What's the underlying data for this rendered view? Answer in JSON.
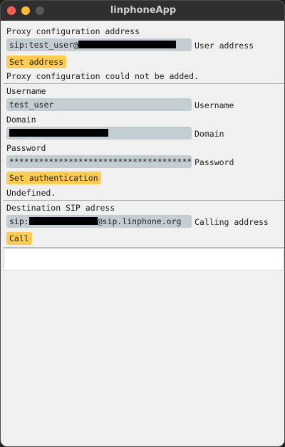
{
  "window": {
    "title": "linphoneApp"
  },
  "proxy": {
    "label": "Proxy configuration address",
    "value_prefix": "sip:test_user@",
    "side_label": "User address",
    "button": "Set address",
    "status": "Proxy configuration could not be added."
  },
  "auth": {
    "username_label": "Username",
    "username_value": "test_user",
    "username_side": "Username",
    "domain_label": "Domain",
    "domain_side": "Domain",
    "password_label": "Password",
    "password_value": "*************************************",
    "password_side": "Password",
    "button": "Set authentication",
    "status": "Undefined."
  },
  "call": {
    "label": "Destination SIP adress",
    "value_prefix": "sip:",
    "value_suffix": "@sip.linphone.org",
    "side_label": "Calling address",
    "button": "Call"
  },
  "colors": {
    "button_bg": "#ffcc4d",
    "field_bg": "#c3cdd2",
    "close": "#ff5f57",
    "minimize": "#febc2e"
  }
}
